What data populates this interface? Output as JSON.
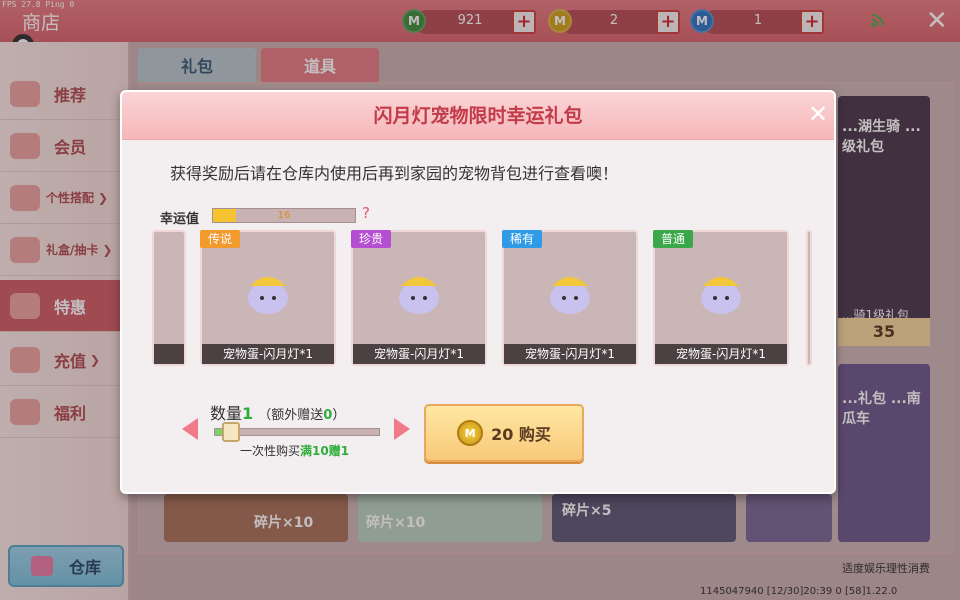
{
  "topbar": {
    "fps": "FPS 27.8  Ping 0",
    "title": "商店",
    "currencies": [
      {
        "icon": "green-coin-icon",
        "value": "921",
        "color": "#3f8f3f"
      },
      {
        "icon": "gold-coin-icon",
        "value": "2",
        "color": "#d1a21e"
      },
      {
        "icon": "blue-coin-icon",
        "value": "1",
        "color": "#2f78c7"
      }
    ],
    "plus": "+",
    "close": "✕"
  },
  "sidebar": {
    "items": [
      {
        "label": "推荐"
      },
      {
        "label": "会员"
      },
      {
        "label": "个性搭配",
        "chev": "❯"
      },
      {
        "label": "礼盒/抽卡",
        "chev": "❯"
      },
      {
        "label": "特惠"
      },
      {
        "label": "充值",
        "chev": "❯"
      },
      {
        "label": "福利"
      }
    ],
    "warehouse": "仓库"
  },
  "tabs": {
    "gift": "礼包",
    "item": "道具"
  },
  "content": {
    "right_card_top": "...湖生骑 ...级礼包",
    "right_card_top_sub": "...骑1级礼包",
    "right_card_top_price": "35",
    "right_card_bottom": "...礼包 ...南瓜车",
    "bottom_cards": [
      "碎片×10",
      "碎片×10",
      "碎片×5"
    ],
    "footer_note": "适度娱乐理性消费",
    "footer_id": "1145047940   [12/30]20:39 0 [58]1.22.0"
  },
  "modal": {
    "title": "闪月灯宠物限时幸运礼包",
    "close": "✕",
    "desc": "获得奖励后请在仓库内使用后再到家园的宠物背包进行查看噢！",
    "luck_label": "幸运值",
    "luck_value": "16",
    "luck_fraction": 0.16,
    "luck_help": "?",
    "slots": [
      {
        "tag": "传说",
        "tag_color": "#f29a2e",
        "name": "宠物蛋-闪月灯*1"
      },
      {
        "tag": "珍贵",
        "tag_color": "#b44fd4",
        "name": "宠物蛋-闪月灯*1"
      },
      {
        "tag": "稀有",
        "tag_color": "#2f9be6",
        "name": "宠物蛋-闪月灯*1"
      },
      {
        "tag": "普通",
        "tag_color": "#3aa84a",
        "name": "宠物蛋-闪月灯*1"
      }
    ],
    "qty_prefix": "数量",
    "qty_value": "1",
    "qty_bonus_prefix": "（额外赠送",
    "qty_bonus_value": "0",
    "qty_bonus_suffix": "）",
    "bulk_prefix": "一次性购买",
    "bulk_highlight": "满10赠1",
    "buy_coin": "M",
    "buy_label": "20 购买"
  }
}
